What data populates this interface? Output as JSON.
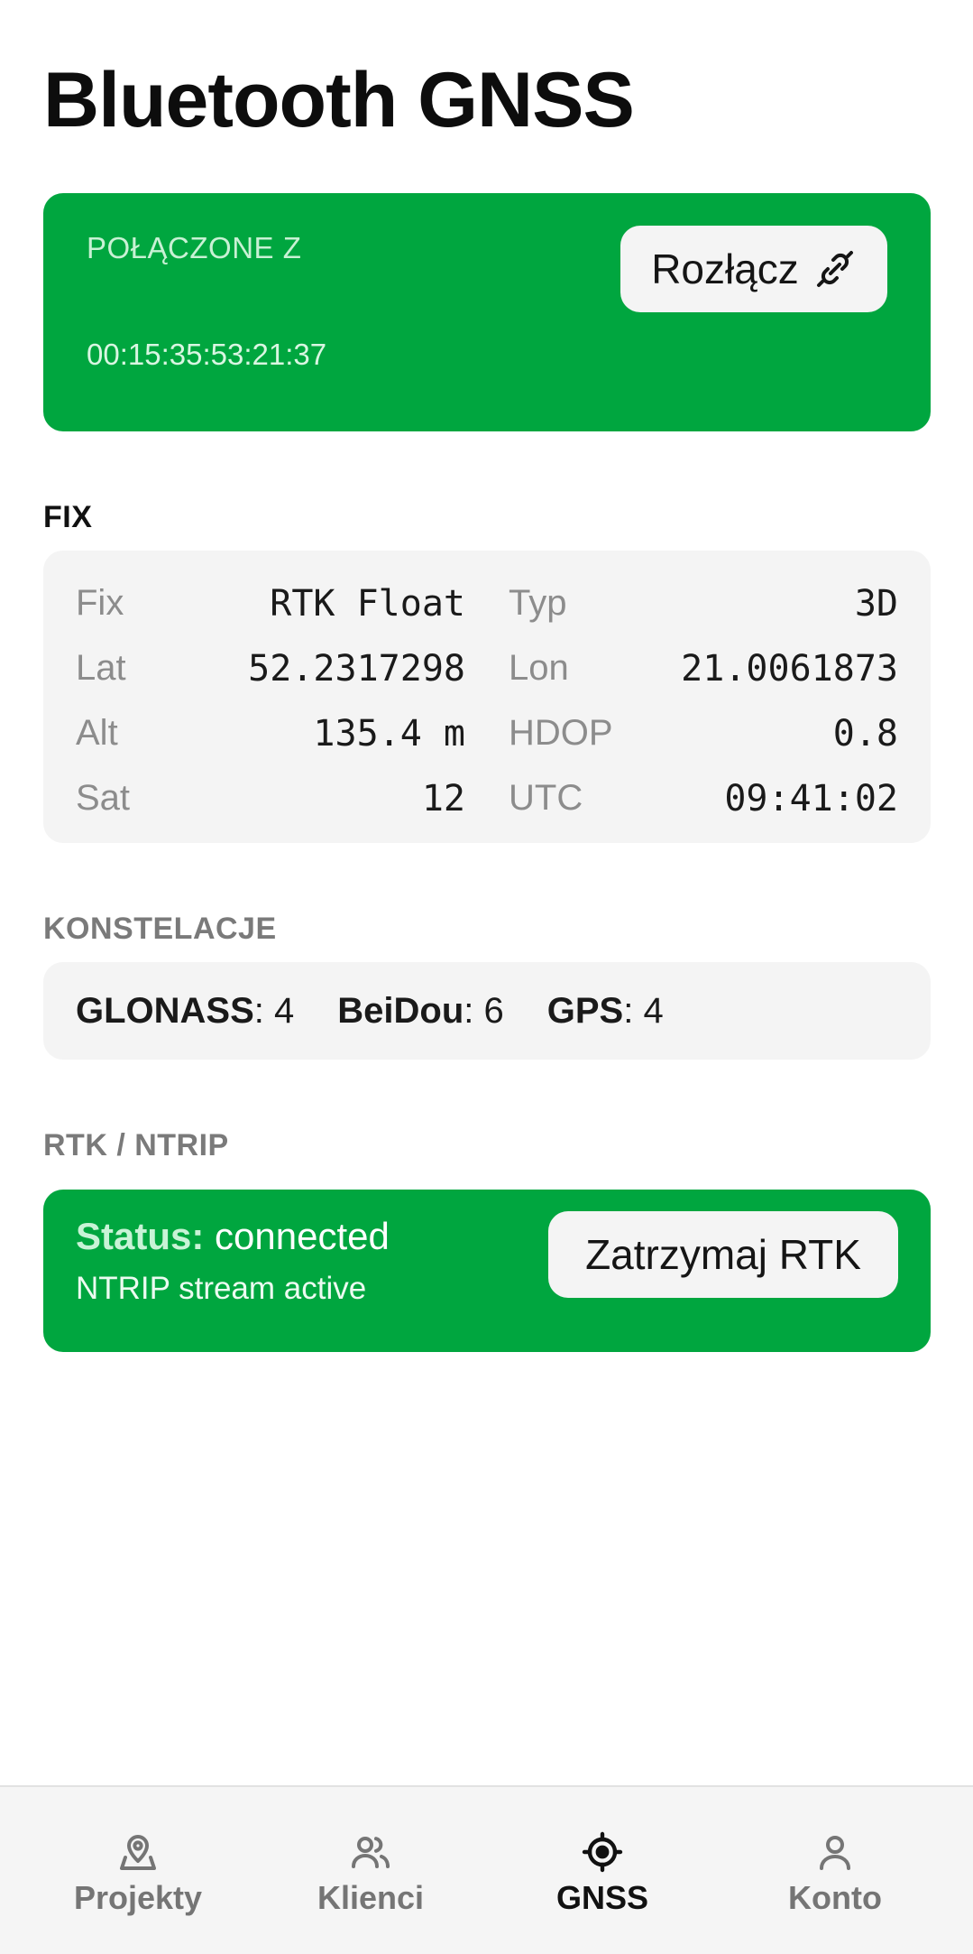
{
  "header": {
    "title": "Bluetooth GNSS"
  },
  "connection": {
    "label": "POŁĄCZONE Z",
    "device_address": "00:15:35:53:21:37",
    "disconnect_label": "Rozłącz",
    "accent_color": "#00a63f"
  },
  "fix": {
    "section_label": "FIX",
    "rows": [
      {
        "k1": "Fix",
        "v1": "RTK Float",
        "k2": "Typ",
        "v2": "3D"
      },
      {
        "k1": "Lat",
        "v1": "52.2317298",
        "k2": "Lon",
        "v2": "21.0061873"
      },
      {
        "k1": "Alt",
        "v1": "135.4 m",
        "k2": "HDOP",
        "v2": "0.8"
      },
      {
        "k1": "Sat",
        "v1": "12",
        "k2": "UTC",
        "v2": "09:41:02"
      }
    ]
  },
  "constellations": {
    "section_label": "KONSTELACJE",
    "items": [
      {
        "name": "GLONASS",
        "value": ": 4"
      },
      {
        "name": "BeiDou",
        "value": ": 6"
      },
      {
        "name": "GPS",
        "value": ": 4"
      }
    ]
  },
  "rtk": {
    "section_label": "RTK / NTRIP",
    "status_label": "Status:",
    "status_value": " connected",
    "stream_text": "NTRIP stream active",
    "stop_label": "Zatrzymaj RTK"
  },
  "nav": {
    "items": [
      {
        "label": "Projekty",
        "icon": "map-pin-icon"
      },
      {
        "label": "Klienci",
        "icon": "users-icon"
      },
      {
        "label": "GNSS",
        "icon": "crosshair-icon",
        "active": true
      },
      {
        "label": "Konto",
        "icon": "user-icon"
      }
    ]
  }
}
